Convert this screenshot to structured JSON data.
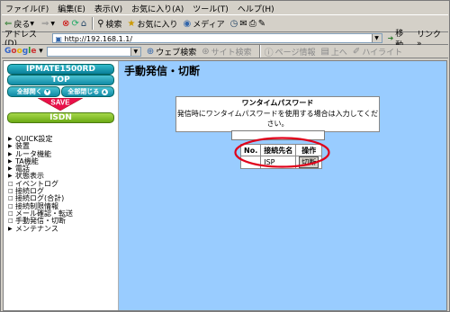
{
  "browser": {
    "menu": [
      "ファイル(F)",
      "編集(E)",
      "表示(V)",
      "お気に入り(A)",
      "ツール(T)",
      "ヘルプ(H)"
    ],
    "toolbar": {
      "back": "戻る",
      "search": "検索",
      "favorites": "お気に入り",
      "media": "メディア"
    },
    "address_label": "アドレス(D)",
    "address_value": "http://192.168.1.1/",
    "go_label": "移動",
    "links_label": "リンク »",
    "google": {
      "logo": "Google",
      "web_search": "ウェブ検索",
      "site_search": "サイト検索",
      "page_info": "ページ情報",
      "up": "上へ",
      "highlight": "ハイライト"
    }
  },
  "sidebar": {
    "logo": "IPMATE1500RD",
    "top_button": "TOP",
    "expand_all": "全部開く",
    "collapse_all": "全部閉じる",
    "save_button": "SAVE",
    "isdn_button": "ISDN",
    "items": [
      {
        "label": "QUICK設定",
        "marker": "▶"
      },
      {
        "label": "装置",
        "marker": "▶"
      },
      {
        "label": "ルータ機能",
        "marker": "▶"
      },
      {
        "label": "TA機能",
        "marker": "▶"
      },
      {
        "label": "電話",
        "marker": "▶"
      },
      {
        "label": "状態表示",
        "marker": "▶"
      },
      {
        "label": "イベントログ",
        "marker": "□"
      },
      {
        "label": "接続ログ",
        "marker": "□"
      },
      {
        "label": "接続ログ(合計)",
        "marker": "□"
      },
      {
        "label": "接続制限情報",
        "marker": "□"
      },
      {
        "label": "メール確認・転送",
        "marker": "□"
      },
      {
        "label": "手動発信・切断",
        "marker": "□"
      },
      {
        "label": "メンテナンス",
        "marker": "▶"
      }
    ]
  },
  "main": {
    "title": "手動発信・切断",
    "password_section": {
      "title": "ワンタイムパスワード",
      "description": "発信時にワンタイムパスワードを使用する場合は入力してください。",
      "value": ""
    },
    "connection_table": {
      "headers": [
        "No.",
        "接続先名",
        "操作"
      ],
      "rows": [
        {
          "no": "",
          "name": "ISP",
          "action": "切断"
        }
      ]
    },
    "highlight_color": "#e0001a"
  }
}
